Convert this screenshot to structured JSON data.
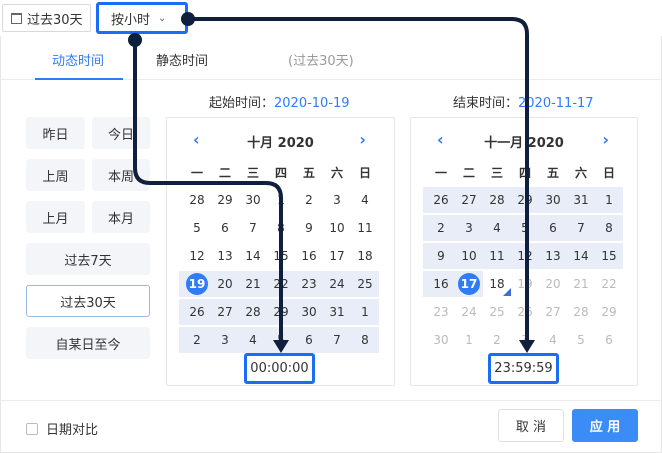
{
  "top": {
    "range_button": "过去30天",
    "granularity_button": "按小时"
  },
  "tabs": [
    "动态时间",
    "静态时间",
    "(过去30天)"
  ],
  "quick": {
    "yesterday": "昨日",
    "today": "今日",
    "last_week": "上周",
    "this_week": "本周",
    "last_month": "上月",
    "this_month": "本月",
    "past7": "过去7天",
    "past30": "过去30天",
    "since": "自某日至今"
  },
  "start": {
    "label": "起始时间：",
    "value": "2020-10-19"
  },
  "end": {
    "label": "结束时间：",
    "value": "2020-11-17"
  },
  "weekdays": [
    "一",
    "二",
    "三",
    "四",
    "五",
    "六",
    "日"
  ],
  "left_cal": {
    "title": "十月 2020",
    "days": [
      [
        "28",
        "29",
        "30",
        "1",
        "2",
        "3",
        "4"
      ],
      [
        "5",
        "6",
        "7",
        "8",
        "9",
        "10",
        "11"
      ],
      [
        "12",
        "13",
        "14",
        "15",
        "16",
        "17",
        "18"
      ],
      [
        "19",
        "20",
        "21",
        "22",
        "23",
        "24",
        "25"
      ],
      [
        "26",
        "27",
        "28",
        "29",
        "30",
        "31",
        "1"
      ],
      [
        "2",
        "3",
        "4",
        "5",
        "6",
        "7",
        "8"
      ]
    ],
    "time": "00:00:00"
  },
  "right_cal": {
    "title": "十一月 2020",
    "days": [
      [
        "26",
        "27",
        "28",
        "29",
        "30",
        "31",
        "1"
      ],
      [
        "2",
        "3",
        "4",
        "5",
        "6",
        "7",
        "8"
      ],
      [
        "9",
        "10",
        "11",
        "12",
        "13",
        "14",
        "15"
      ],
      [
        "16",
        "17",
        "18",
        "19",
        "20",
        "21",
        "22"
      ],
      [
        "23",
        "24",
        "25",
        "26",
        "27",
        "28",
        "29"
      ],
      [
        "30",
        "1",
        "2",
        "3",
        "4",
        "5",
        "6"
      ]
    ],
    "time": "23:59:59"
  },
  "footer": {
    "compare": "日期对比",
    "cancel": "取 消",
    "apply": "应 用"
  },
  "colors": {
    "accent": "#2f7cf6",
    "highlight": "#e8edf8",
    "annotation_blue": "#1a6ef5",
    "arrow_navy": "#0f1f3d"
  }
}
